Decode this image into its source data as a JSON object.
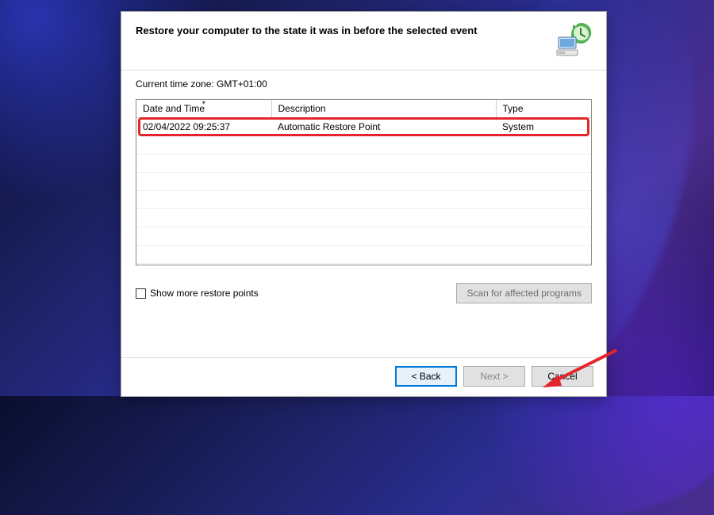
{
  "dialog": {
    "title": "Restore your computer to the state it was in before the selected event",
    "timezone_label": "Current time zone: GMT+01:00",
    "columns": {
      "date": "Date and Time",
      "description": "Description",
      "type": "Type"
    },
    "rows": [
      {
        "date": "02/04/2022 09:25:37",
        "description": "Automatic Restore Point",
        "type": "System"
      }
    ],
    "show_more_label": "Show more restore points",
    "scan_label": "Scan for affected programs"
  },
  "footer": {
    "back": "< Back",
    "next": "Next >",
    "cancel": "Cancel"
  }
}
